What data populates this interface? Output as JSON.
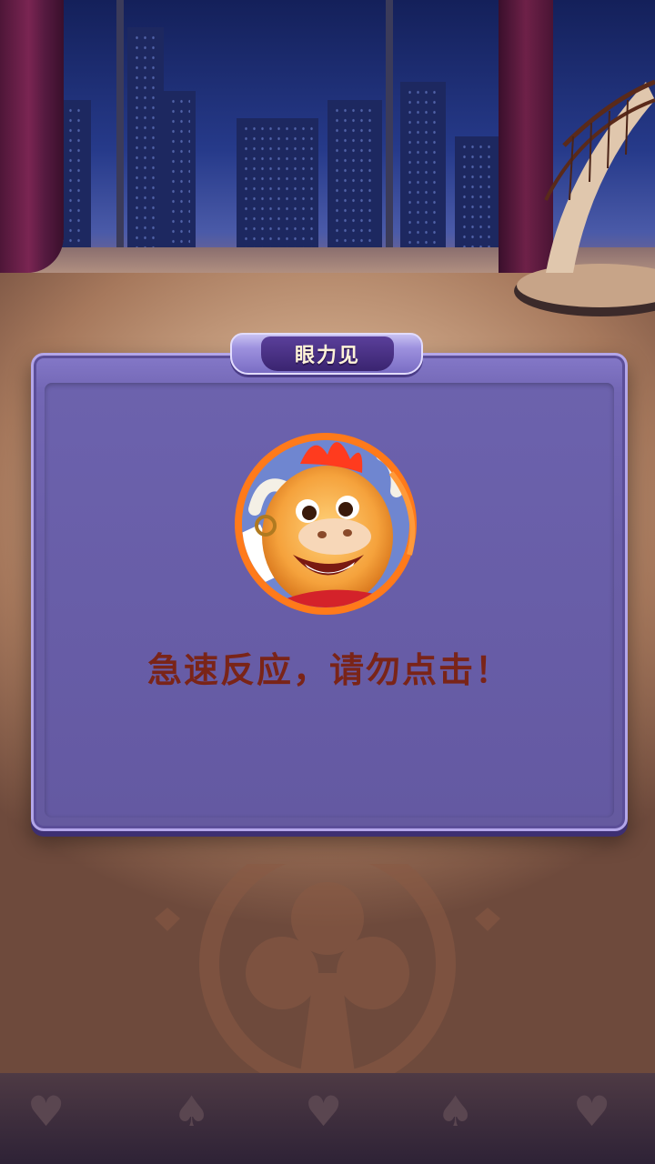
{
  "dialog": {
    "title": "眼力见",
    "message": "急速反应，请勿点击！"
  },
  "icons": {
    "avatar": "cartoon-bull-avatar-icon",
    "floor_ornament": "club-suit-ornament-icon",
    "border_suits": [
      "heart-icon",
      "spade-icon",
      "heart-icon",
      "spade-icon",
      "heart-icon"
    ]
  },
  "colors": {
    "dialog_fill": "#6a5ea8",
    "dialog_border": "#b3a6ea",
    "title_text": "#fff4d8",
    "message_text": "#7a2418",
    "avatar_ring": "#ff7a1a"
  }
}
